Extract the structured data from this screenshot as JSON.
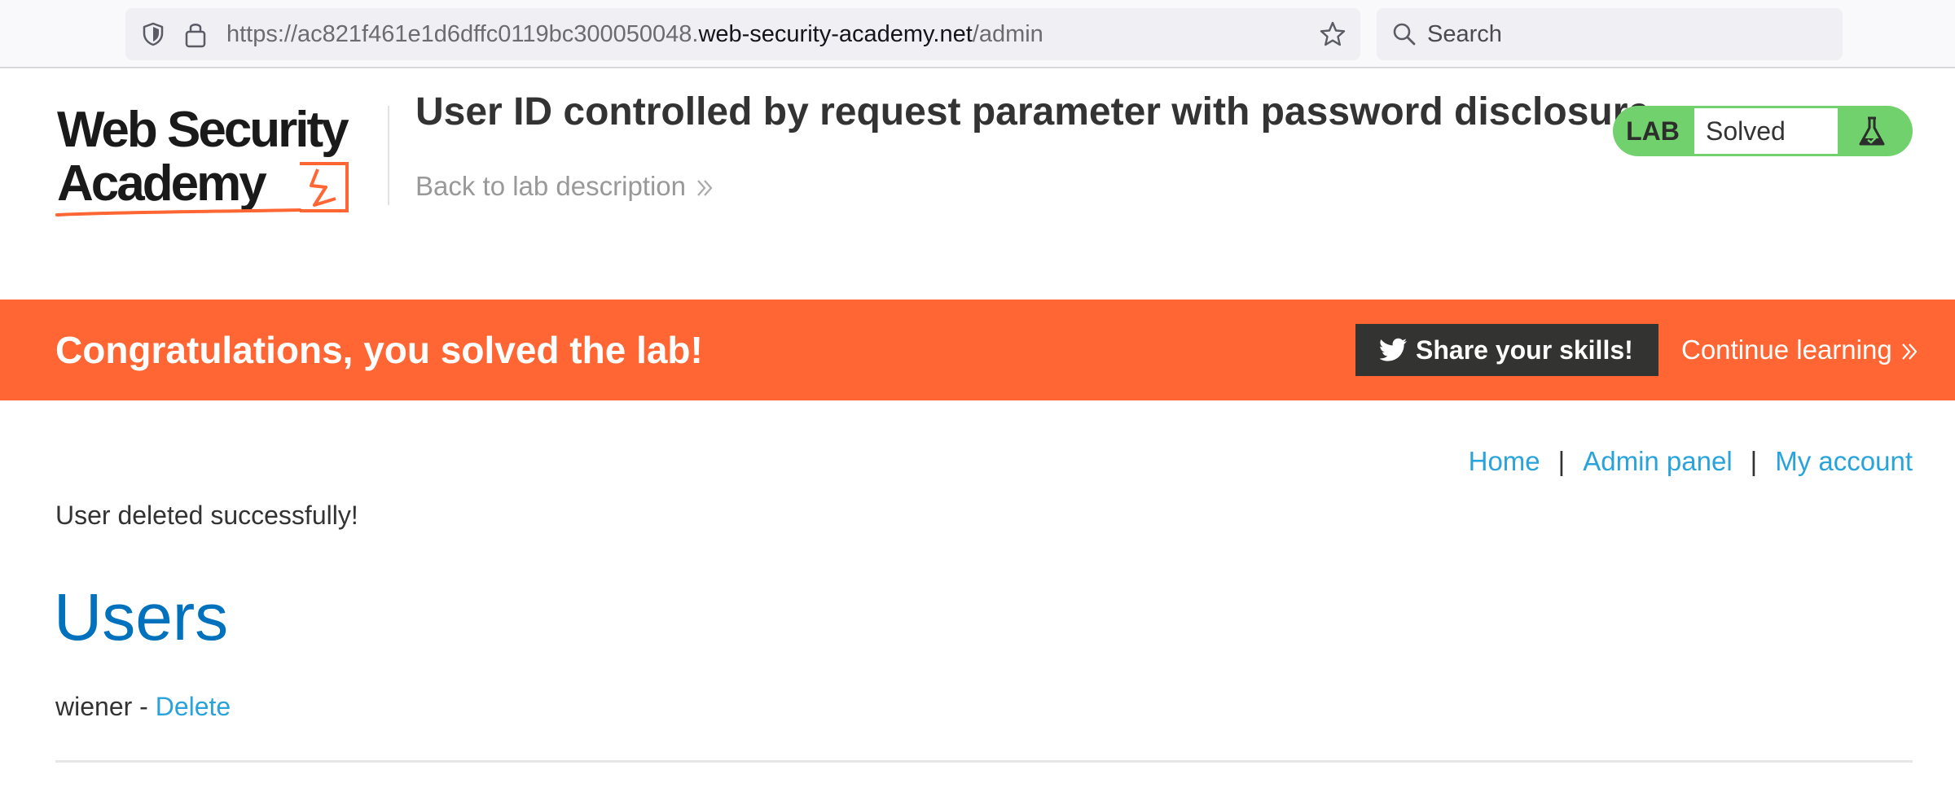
{
  "browser": {
    "url_prefix": "https://ac821f461e1d6dffc0119bc300050048.",
    "url_host": "web-security-academy.net",
    "url_path": "/admin",
    "search_placeholder": "Search"
  },
  "header": {
    "logo_text": "Web Security Academy",
    "lab_title": "User ID controlled by request parameter with password disclosure",
    "back_link": "Back to lab description",
    "lab_badge": "LAB",
    "lab_status": "Solved"
  },
  "banner": {
    "message": "Congratulations, you solved the lab!",
    "share_button": "Share your skills!",
    "continue_link": "Continue learning"
  },
  "nav": {
    "home": "Home",
    "separator": "|",
    "admin_panel": "Admin panel",
    "my_account": "My account"
  },
  "main": {
    "message": "User deleted successfully!",
    "heading": "Users",
    "users": [
      {
        "name": "wiener",
        "dash": " - ",
        "action": "Delete"
      }
    ]
  },
  "colors": {
    "banner": "#ff6633",
    "lab_solved": "#70d16d",
    "link": "#29a3db",
    "heading": "#0071bc"
  },
  "icons": [
    "shield-icon",
    "lock-icon",
    "star-icon",
    "search-icon",
    "flask-icon",
    "twitter-icon",
    "chevron-double-right-icon"
  ]
}
